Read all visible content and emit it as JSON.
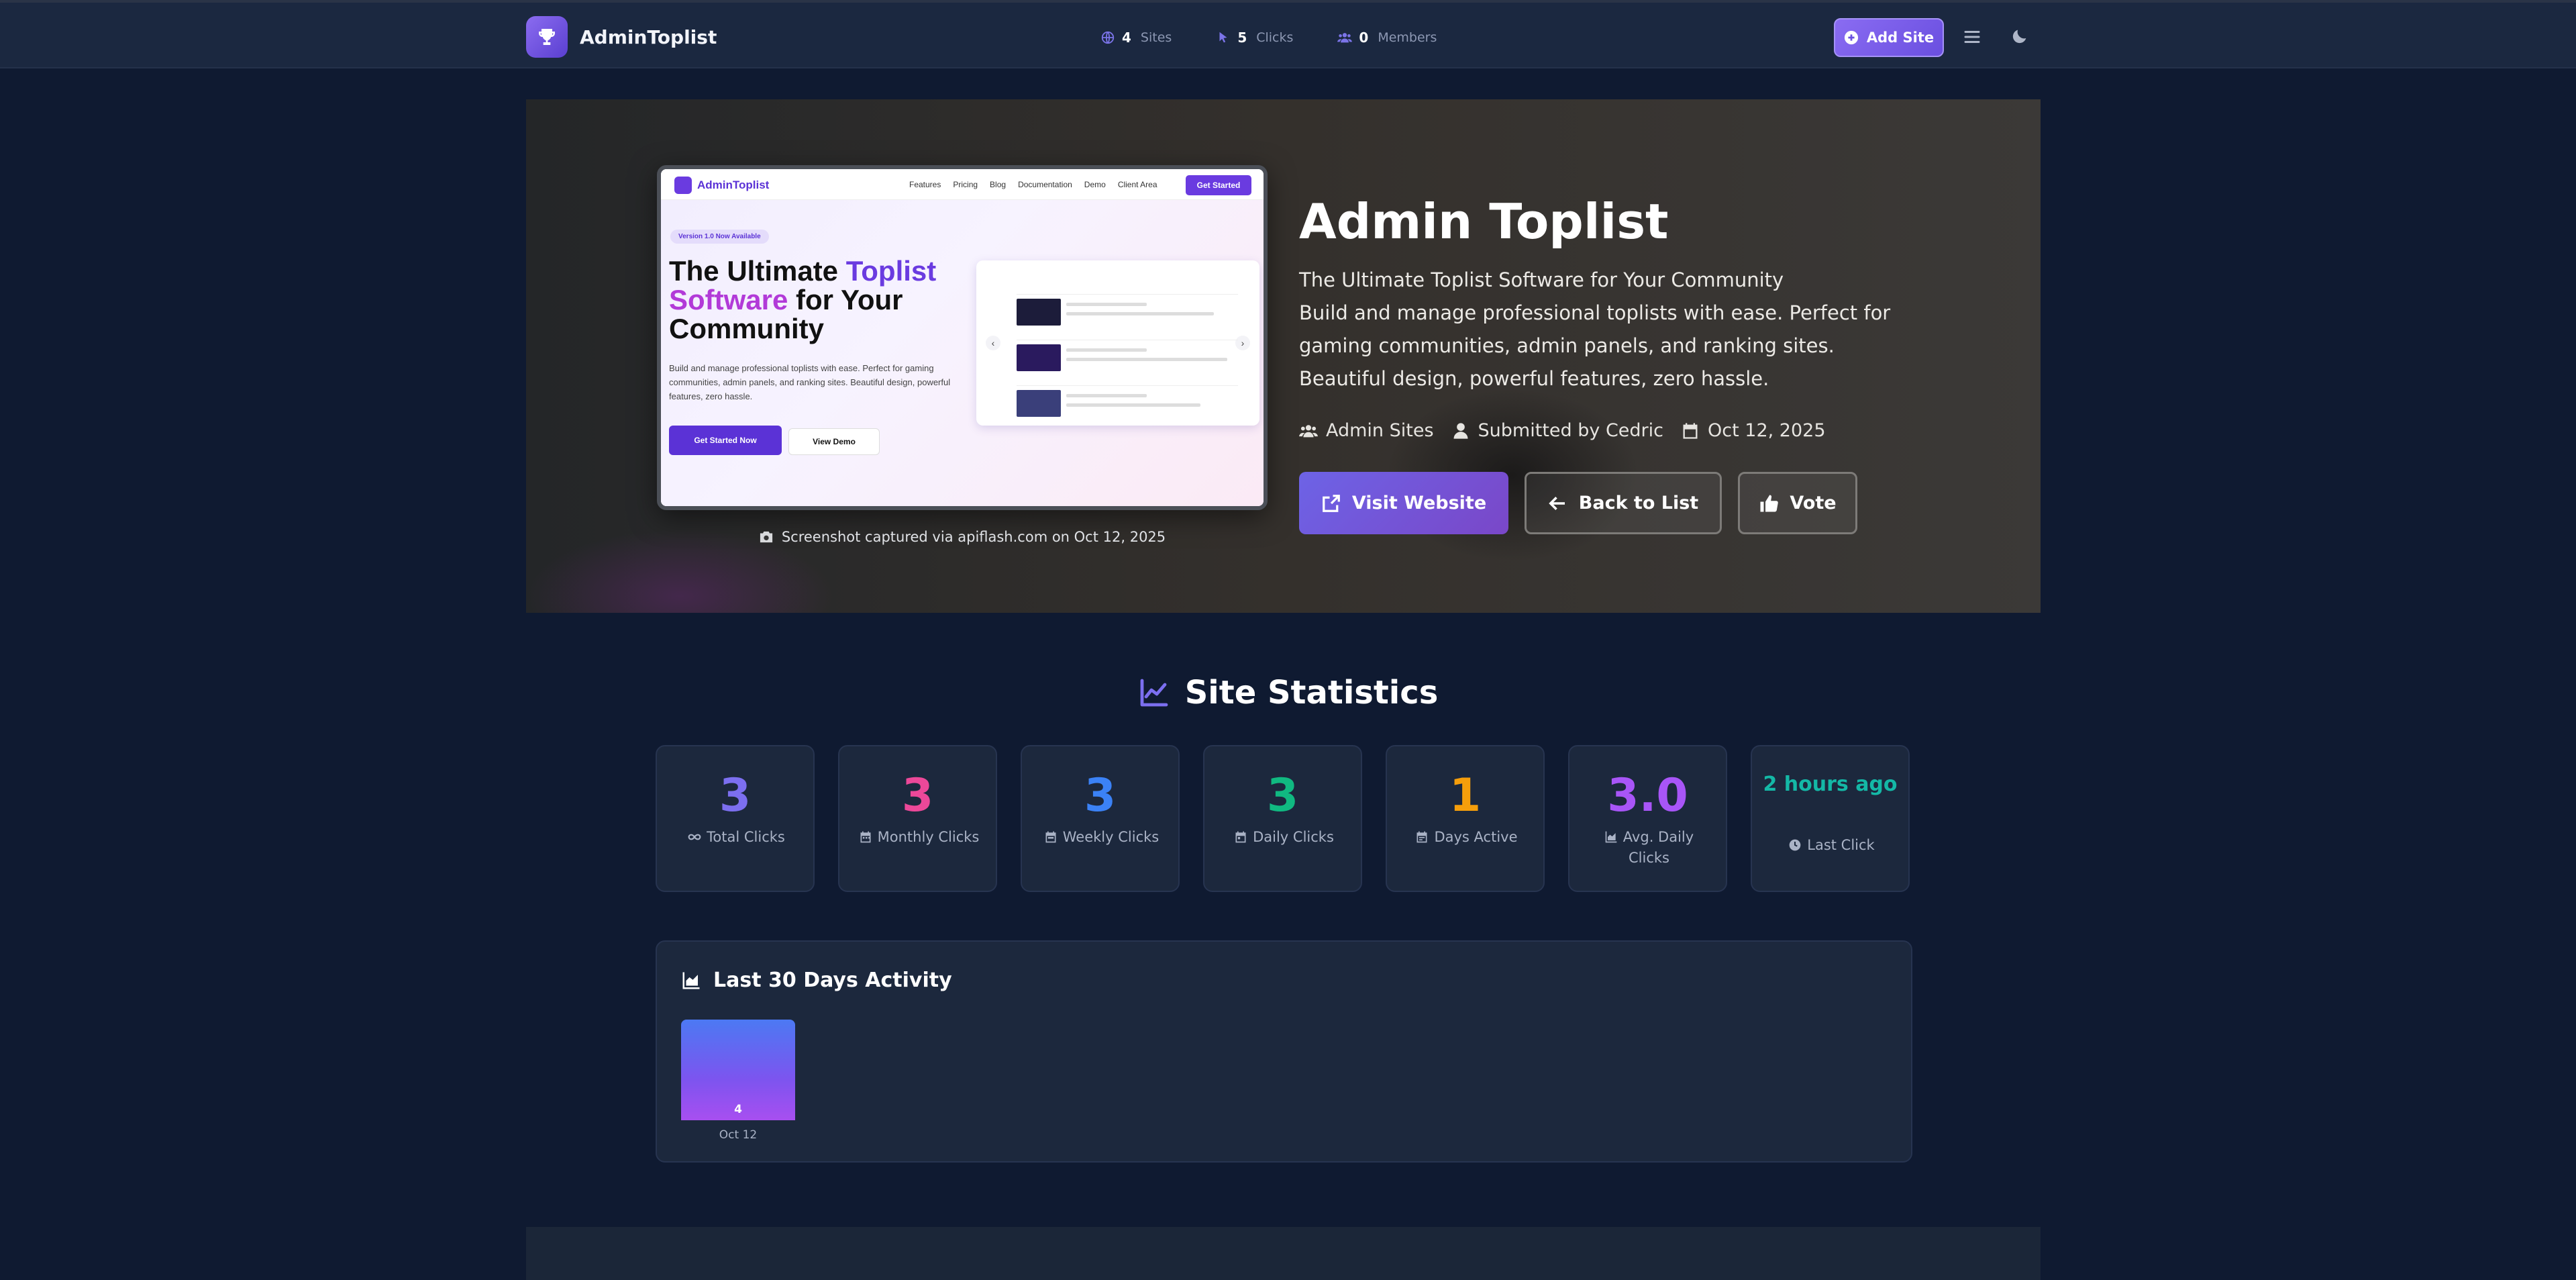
{
  "nav": {
    "brand": "AdminToplist",
    "stats": [
      {
        "icon": "globe-icon",
        "value": "4",
        "label": "Sites"
      },
      {
        "icon": "pointer-icon",
        "value": "5",
        "label": "Clicks"
      },
      {
        "icon": "users-icon",
        "value": "0",
        "label": "Members"
      }
    ],
    "add_site": "Add Site"
  },
  "hero": {
    "preview": {
      "brand": "AdminToplist",
      "links": [
        "Features",
        "Pricing",
        "Blog",
        "Documentation",
        "Demo",
        "Client Area"
      ],
      "cta": "Get Started",
      "pill": "Version 1.0 Now Available",
      "h1_a": "The Ultimate ",
      "h1_b": "Toplist",
      "h1_c": "Software",
      "h1_d": " for Your Community",
      "paragraph": "Build and manage professional toplists with ease. Perfect for gaming communities, admin panels, and ranking sites. Beautiful design, powerful features, zero hassle.",
      "btn_primary": "Get Started Now",
      "btn_secondary": "View Demo",
      "prev_arrow": "‹",
      "next_arrow": "›"
    },
    "caption": "Screenshot captured via apiflash.com on Oct 12, 2025",
    "title": "Admin Toplist",
    "description": "The Ultimate Toplist Software for Your Community\nBuild and manage professional toplists with ease. Perfect for gaming communities, admin panels, and ranking sites. Beautiful design, powerful features, zero hassle.",
    "meta": {
      "category": "Admin Sites",
      "submitted_by": "Submitted by Cedric",
      "date": "Oct 12, 2025"
    },
    "buttons": {
      "visit": "Visit Website",
      "back": "Back to List",
      "vote": "Vote"
    }
  },
  "statistics": {
    "heading": "Site Statistics",
    "cards": [
      {
        "value": "3",
        "label": "Total Clicks",
        "color": "#7c6ff0",
        "icon": "infinity-icon"
      },
      {
        "value": "3",
        "label": "Monthly Clicks",
        "color": "#ec4899",
        "icon": "calendar-icon"
      },
      {
        "value": "3",
        "label": "Weekly Clicks",
        "color": "#3b82f6",
        "icon": "calendar-week-icon"
      },
      {
        "value": "3",
        "label": "Daily Clicks",
        "color": "#10b981",
        "icon": "calendar-day-icon"
      },
      {
        "value": "1",
        "label": "Days Active",
        "color": "#f59e0b",
        "icon": "calendar-check-icon"
      },
      {
        "value": "3.0",
        "label": "Avg. Daily Clicks",
        "color": "#a855f7",
        "icon": "chart-area-icon"
      },
      {
        "value": "2 hours ago",
        "label": "Last Click",
        "color": "#14b8a6",
        "icon": "clock-icon"
      }
    ]
  },
  "activity": {
    "title": "Last 30 Days Activity",
    "days": [
      {
        "label": "Oct 12",
        "value": 4
      }
    ]
  }
}
